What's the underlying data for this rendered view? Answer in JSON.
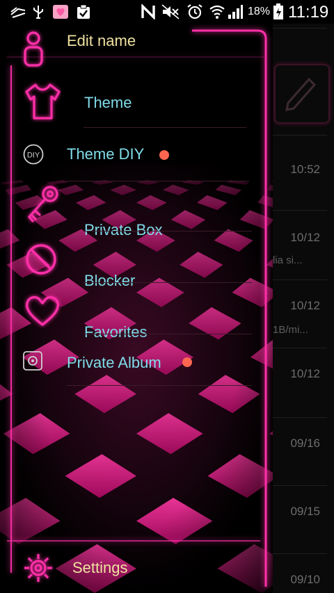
{
  "status_bar": {
    "battery": "18%",
    "time": "11:19"
  },
  "drawer": {
    "header": {
      "label": "Edit name"
    },
    "items": [
      {
        "label": "Theme",
        "icon": "tshirt-icon"
      },
      {
        "label": "Theme DIY",
        "icon": "diy-icon",
        "new_badge": true
      },
      {
        "label": "Private Box",
        "icon": "key-icon"
      },
      {
        "label": "Blocker",
        "icon": "block-icon"
      },
      {
        "label": "Favorites",
        "icon": "heart-icon"
      },
      {
        "label": "Private Album",
        "icon": "album-icon",
        "new_badge": true
      }
    ],
    "footer": {
      "label": "Settings",
      "icon": "gear-icon"
    }
  },
  "background_list": {
    "rows": [
      {
        "date": "10:52",
        "snippet": ""
      },
      {
        "date": "10/12",
        "snippet": "lia si..."
      },
      {
        "date": "10/12",
        "snippet": "1B/mi..."
      },
      {
        "date": "10/12",
        "snippet": ""
      },
      {
        "date": "09/16",
        "snippet": ""
      },
      {
        "date": "09/15",
        "snippet": ""
      },
      {
        "date": "09/10",
        "snippet": ""
      }
    ]
  },
  "colors": {
    "neon_pink": "#ff2fa8",
    "label_cyan": "#7fdce9",
    "label_yellow": "#f0e2a0",
    "badge_orange": "#ff6650"
  }
}
